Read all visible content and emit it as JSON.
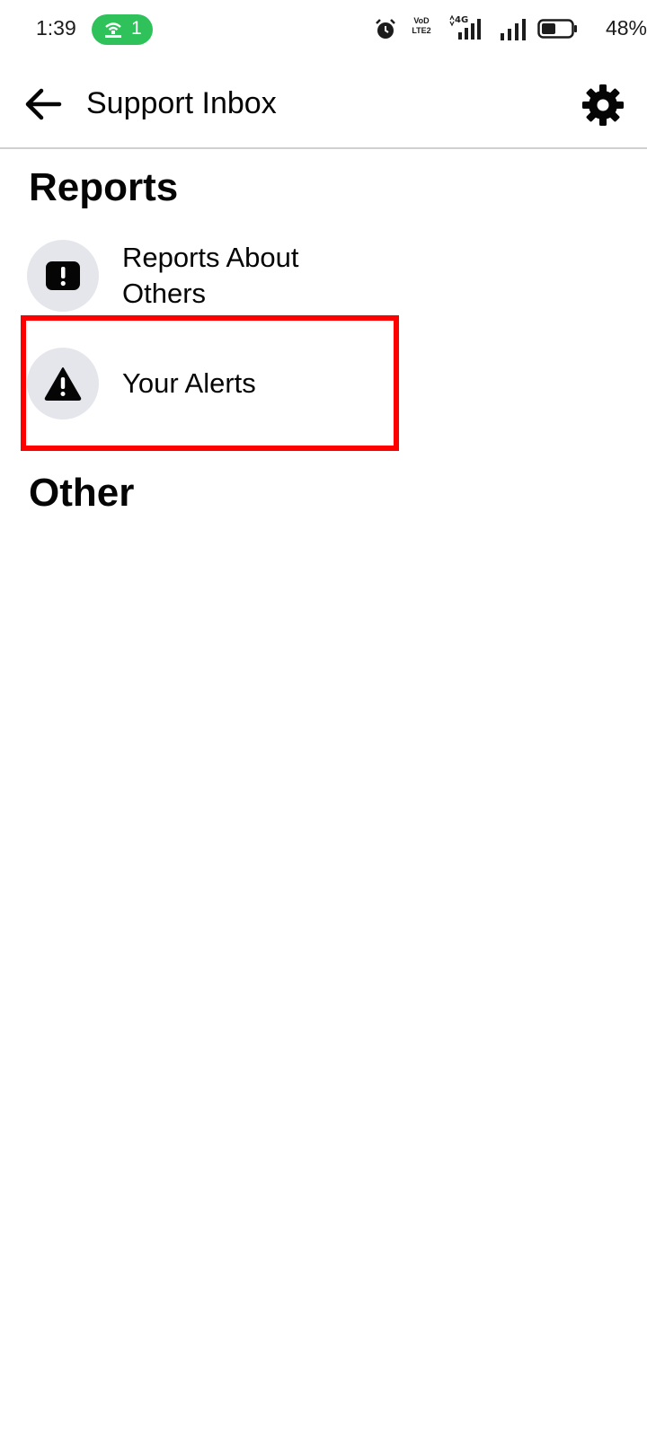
{
  "status_bar": {
    "time": "1:39",
    "hotspot_count": "1",
    "network_label": "VoD LTE2",
    "network_type": "4G",
    "battery": "48%",
    "hotspot_color": "#2fc25b"
  },
  "header": {
    "title": "Support Inbox",
    "back_icon": "arrow-left-icon",
    "settings_icon": "gear-icon"
  },
  "sections": {
    "reports": {
      "heading": "Reports",
      "items": [
        {
          "label": "Reports About Others",
          "icon": "exclamation-square-icon"
        },
        {
          "label": "Your Alerts",
          "icon": "warning-triangle-icon"
        }
      ]
    },
    "other": {
      "heading": "Other"
    }
  },
  "highlight": {
    "color": "#ff0000",
    "target": "Your Alerts"
  }
}
